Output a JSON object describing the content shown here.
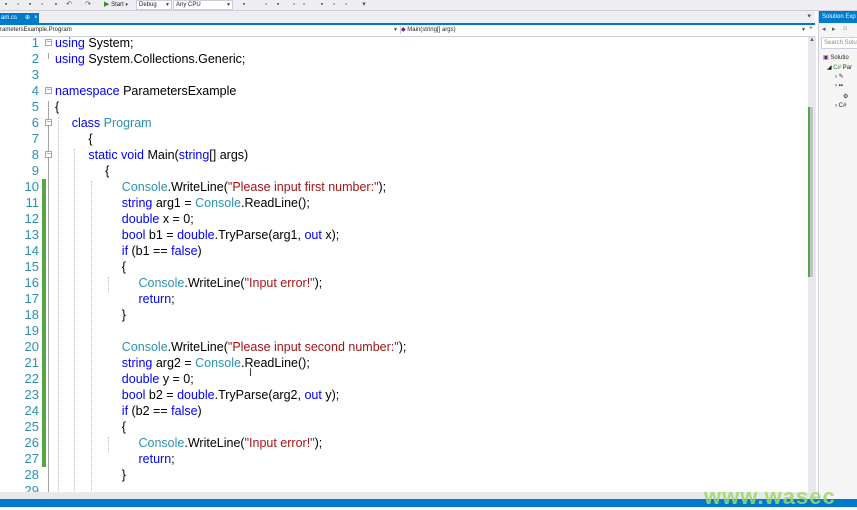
{
  "toolbar": {
    "start_label": "Start",
    "config": "Debug",
    "platform": "Any CPU"
  },
  "tab": {
    "title": "am.cs",
    "pin": "⊕",
    "close": "×"
  },
  "navbar": {
    "left": "rametersExample.Program",
    "right": "Main(string[] args)"
  },
  "solution_explorer": {
    "title": "Solution Exp",
    "search_placeholder": "Search Solut",
    "items": [
      "Solutio",
      "Par"
    ]
  },
  "code_lines": [
    {
      "n": "1",
      "tokens": [
        [
          "kw",
          "using"
        ],
        [
          "",
          "System;"
        ]
      ]
    },
    {
      "n": "2",
      "tokens": [
        [
          "kw",
          "using"
        ],
        [
          "",
          "System.Collections.Generic;"
        ]
      ]
    },
    {
      "n": "3",
      "tokens": []
    },
    {
      "n": "4",
      "tokens": [
        [
          "kw",
          "namespace"
        ],
        [
          "",
          " ParametersExample"
        ]
      ]
    },
    {
      "n": "5",
      "tokens": [
        [
          "",
          "{"
        ]
      ]
    },
    {
      "n": "6",
      "tokens": [
        [
          "kw",
          "class"
        ],
        [
          "",
          " "
        ],
        [
          "ty",
          "Program"
        ]
      ]
    },
    {
      "n": "7",
      "tokens": [
        [
          "",
          "{"
        ]
      ]
    },
    {
      "n": "8",
      "tokens": [
        [
          "kw",
          "static void"
        ],
        [
          "",
          " Main("
        ],
        [
          "kw",
          "string"
        ],
        [
          "",
          "[] args)"
        ]
      ]
    },
    {
      "n": "9",
      "tokens": [
        [
          "",
          "{"
        ]
      ]
    },
    {
      "n": "10",
      "tokens": [
        [
          "ty",
          "Console"
        ],
        [
          "",
          ".WriteLine("
        ],
        [
          "st",
          "\"Please input first number:\""
        ],
        [
          "",
          ");"
        ]
      ]
    },
    {
      "n": "11",
      "tokens": [
        [
          "kw",
          "string"
        ],
        [
          "",
          " arg1 = "
        ],
        [
          "ty",
          "Console"
        ],
        [
          "",
          ".ReadLine();"
        ]
      ]
    },
    {
      "n": "12",
      "tokens": [
        [
          "kw",
          "double"
        ],
        [
          "",
          " x = 0;"
        ]
      ]
    },
    {
      "n": "13",
      "tokens": [
        [
          "kw",
          "bool"
        ],
        [
          "",
          " b1 = "
        ],
        [
          "kw",
          "double"
        ],
        [
          "",
          ".TryParse(arg1, "
        ],
        [
          "kw",
          "out"
        ],
        [
          "",
          " x);"
        ]
      ]
    },
    {
      "n": "14",
      "tokens": [
        [
          "kw",
          "if"
        ],
        [
          "",
          " (b1 == "
        ],
        [
          "kw",
          "false"
        ],
        [
          "",
          ")"
        ]
      ]
    },
    {
      "n": "15",
      "tokens": [
        [
          "",
          "{"
        ]
      ]
    },
    {
      "n": "16",
      "tokens": [
        [
          "ty",
          "Console"
        ],
        [
          "",
          ".WriteLine("
        ],
        [
          "st",
          "\"Input error!\""
        ],
        [
          "",
          ");"
        ]
      ]
    },
    {
      "n": "17",
      "tokens": [
        [
          "kw",
          "return"
        ],
        [
          "",
          ";"
        ]
      ]
    },
    {
      "n": "18",
      "tokens": [
        [
          "",
          "}"
        ]
      ]
    },
    {
      "n": "19",
      "tokens": []
    },
    {
      "n": "20",
      "tokens": [
        [
          "ty",
          "Console"
        ],
        [
          "",
          ".WriteLine("
        ],
        [
          "st",
          "\"Please input second number:\""
        ],
        [
          "",
          ");"
        ]
      ]
    },
    {
      "n": "21",
      "tokens": [
        [
          "kw",
          "string"
        ],
        [
          "",
          " arg2 = "
        ],
        [
          "ty",
          "Console"
        ],
        [
          "",
          ".ReadLine();"
        ]
      ]
    },
    {
      "n": "22",
      "tokens": [
        [
          "kw",
          "double"
        ],
        [
          "",
          " y = 0;"
        ]
      ]
    },
    {
      "n": "23",
      "tokens": [
        [
          "kw",
          "bool"
        ],
        [
          "",
          " b2 = "
        ],
        [
          "kw",
          "double"
        ],
        [
          "",
          ".TryParse(arg2, "
        ],
        [
          "kw",
          "out"
        ],
        [
          "",
          " y);"
        ]
      ]
    },
    {
      "n": "24",
      "tokens": [
        [
          "kw",
          "if"
        ],
        [
          "",
          " (b2 == "
        ],
        [
          "kw",
          "false"
        ],
        [
          "",
          ")"
        ]
      ]
    },
    {
      "n": "25",
      "tokens": [
        [
          "",
          "{"
        ]
      ]
    },
    {
      "n": "26",
      "tokens": [
        [
          "ty",
          "Console"
        ],
        [
          "",
          ".WriteLine("
        ],
        [
          "st",
          "\"Input error!\""
        ],
        [
          "",
          ");"
        ]
      ]
    },
    {
      "n": "27",
      "tokens": [
        [
          "kw",
          "return"
        ],
        [
          "",
          ";"
        ]
      ]
    },
    {
      "n": "28",
      "tokens": [
        [
          "",
          "}"
        ]
      ]
    },
    {
      "n": "29",
      "tokens": []
    }
  ],
  "watermark": "www.wasec"
}
